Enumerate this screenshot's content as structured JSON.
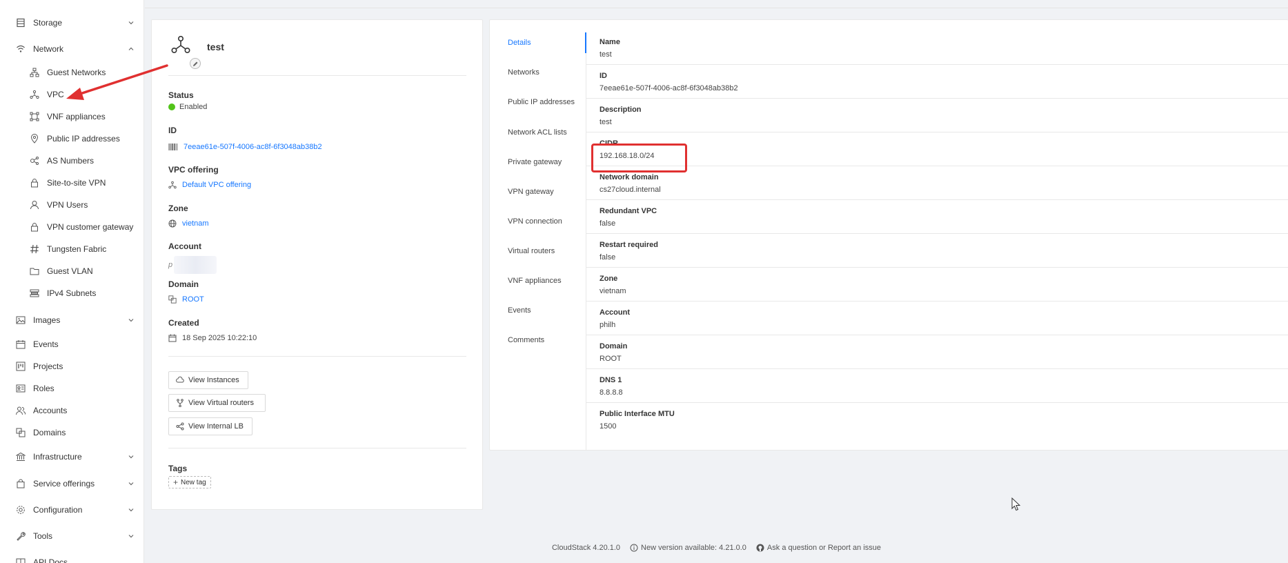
{
  "sidebar": {
    "top_items": [
      {
        "label": "Storage",
        "icon": "database-icon",
        "chevron": "down"
      },
      {
        "label": "Network",
        "icon": "wifi-icon",
        "chevron": "up"
      }
    ],
    "network_items": [
      {
        "label": "Guest Networks",
        "icon": "apartment-icon"
      },
      {
        "label": "VPC",
        "icon": "deployment-unit-icon"
      },
      {
        "label": "VNF appliances",
        "icon": "gateway-icon"
      },
      {
        "label": "Public IP addresses",
        "icon": "environment-icon"
      },
      {
        "label": "AS Numbers",
        "icon": "cluster-icon"
      },
      {
        "label": "Site-to-site VPN",
        "icon": "lock-icon"
      },
      {
        "label": "VPN Users",
        "icon": "user-icon"
      },
      {
        "label": "VPN customer gateway",
        "icon": "lock-icon"
      },
      {
        "label": "Tungsten Fabric",
        "icon": "hash-icon"
      },
      {
        "label": "Guest VLAN",
        "icon": "folder-icon"
      },
      {
        "label": "IPv4 Subnets",
        "icon": "subnet-icon"
      }
    ],
    "bottom_items": [
      {
        "label": "Images",
        "icon": "picture-icon",
        "chevron": "down"
      },
      {
        "label": "Events",
        "icon": "schedule-icon"
      },
      {
        "label": "Projects",
        "icon": "project-icon"
      },
      {
        "label": "Roles",
        "icon": "idcard-icon"
      },
      {
        "label": "Accounts",
        "icon": "team-icon"
      },
      {
        "label": "Domains",
        "icon": "block-icon"
      },
      {
        "label": "Infrastructure",
        "icon": "bank-icon",
        "chevron": "down"
      },
      {
        "label": "Service offerings",
        "icon": "shopping-icon",
        "chevron": "down"
      },
      {
        "label": "Configuration",
        "icon": "setting-icon",
        "chevron": "down"
      },
      {
        "label": "Tools",
        "icon": "tool-icon",
        "chevron": "down"
      },
      {
        "label": "API Docs",
        "icon": "read-icon"
      }
    ]
  },
  "info": {
    "name": "test",
    "status_label": "Status",
    "status_value": "Enabled",
    "status_color": "#52c41a",
    "id_label": "ID",
    "id_value": "7eeae61e-507f-4006-ac8f-6f3048ab38b2",
    "vpc_offering_label": "VPC offering",
    "vpc_offering_value": "Default VPC offering",
    "zone_label": "Zone",
    "zone_value": "vietnam",
    "account_label": "Account",
    "account_value": "p",
    "domain_label": "Domain",
    "domain_value": "ROOT",
    "created_label": "Created",
    "created_value": "18 Sep 2025 10:22:10",
    "buttons": {
      "view_instances": "View Instances",
      "view_virtual_routers": "View Virtual routers",
      "view_internal_lb": "View Internal LB"
    },
    "tags_label": "Tags",
    "new_tag": "New tag"
  },
  "tabs": [
    "Details",
    "Networks",
    "Public IP addresses",
    "Network ACL lists",
    "Private gateway",
    "VPN gateway",
    "VPN connection",
    "Virtual routers",
    "VNF appliances",
    "Events",
    "Comments"
  ],
  "details": [
    {
      "key": "Name",
      "value": "test"
    },
    {
      "key": "ID",
      "value": "7eeae61e-507f-4006-ac8f-6f3048ab38b2"
    },
    {
      "key": "Description",
      "value": "test"
    },
    {
      "key": "CIDR",
      "value": "192.168.18.0/24"
    },
    {
      "key": "Network domain",
      "value": "cs27cloud.internal"
    },
    {
      "key": "Redundant VPC",
      "value": "false"
    },
    {
      "key": "Restart required",
      "value": "false"
    },
    {
      "key": "Zone",
      "value": "vietnam"
    },
    {
      "key": "Account",
      "value": "philh"
    },
    {
      "key": "Domain",
      "value": "ROOT"
    },
    {
      "key": "DNS 1",
      "value": "8.8.8.8"
    },
    {
      "key": "Public Interface MTU",
      "value": "1500"
    }
  ],
  "footer": {
    "version": "CloudStack 4.20.1.0",
    "new_version": "New version available: 4.21.0.0",
    "ask": "Ask a question or Report an issue"
  },
  "colors": {
    "accent": "#1677ff",
    "annotation_red": "#e03030"
  }
}
